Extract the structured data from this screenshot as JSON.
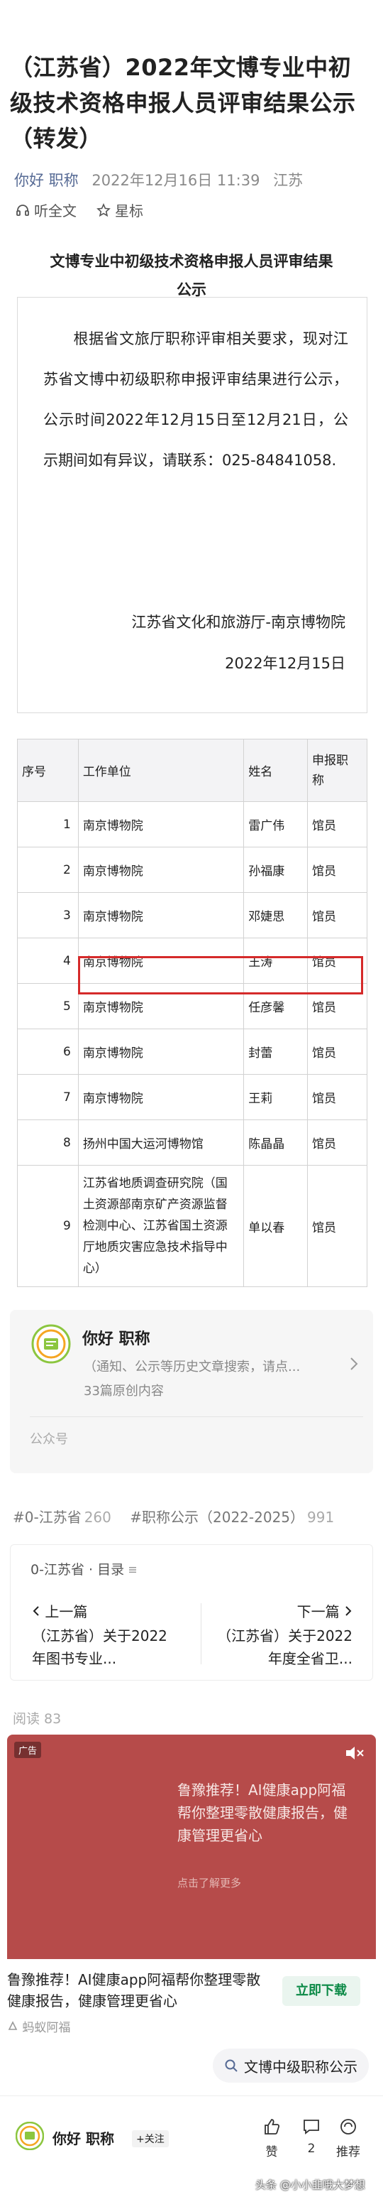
{
  "article": {
    "title": "（江苏省）2022年文博专业中初级技术资格申报人员评审结果公示（转发）",
    "meta": {
      "source": "你好 职称",
      "date": "2022年12月16日 11:39",
      "location": "江苏"
    },
    "actions": {
      "listen_label": "听全文",
      "star_label": "星标"
    }
  },
  "document": {
    "heading_line1": "文博专业中初级技术资格申报人员评审结果",
    "heading_line2": "公示",
    "notice_text": "根据省文旅厅职称评审相关要求，现对江苏省文博中初级职称申报评审结果进行公示，公示时间2022年12月15日至12月21日，公示期间如有异议，请联系：025-84841058.",
    "org": "江苏省文化和旅游厅-南京博物院",
    "date": "2022年12月15日"
  },
  "table": {
    "headers": [
      "序号",
      "工作单位",
      "姓名",
      "申报职称"
    ],
    "rows": [
      {
        "no": "1",
        "unit": "南京博物院",
        "name": "雷广伟",
        "title": "馆员"
      },
      {
        "no": "2",
        "unit": "南京博物院",
        "name": "孙福康",
        "title": "馆员"
      },
      {
        "no": "3",
        "unit": "南京博物院",
        "name": "邓婕思",
        "title": "馆员"
      },
      {
        "no": "4",
        "unit": "南京博物院",
        "name": "王涛",
        "title": "馆员"
      },
      {
        "no": "5",
        "unit": "南京博物院",
        "name": "任彦馨",
        "title": "馆员"
      },
      {
        "no": "6",
        "unit": "南京博物院",
        "name": "封蕾",
        "title": "馆员"
      },
      {
        "no": "7",
        "unit": "南京博物院",
        "name": "王莉",
        "title": "馆员"
      },
      {
        "no": "8",
        "unit": "扬州中国大运河博物馆",
        "name": "陈晶晶",
        "title": "馆员"
      },
      {
        "no": "9",
        "unit": "江苏省地质调查研究院（国土资源部南京矿产资源监督检测中心、江苏省国土资源厅地质灾害应急技术指导中心）",
        "name": "单以春",
        "title": "馆员"
      }
    ],
    "highlight_color": "#d52a2a"
  },
  "account": {
    "name": "你好 职称",
    "description": "（通知、公示等历史文章搜索，请点...",
    "count": "33篇原创内容",
    "type": "公众号",
    "logo_icon": "account-logo-icon"
  },
  "tags": [
    {
      "label": "#0-江苏省",
      "count": "260"
    },
    {
      "label": "#职称公示（2022-2025）",
      "count": "991"
    }
  ],
  "collection": {
    "name": "0-江苏省",
    "directory_label": "目录",
    "prev_label": "上一篇",
    "prev_title": "（江苏省）关于2022年图书专业...",
    "next_label": "下一篇",
    "next_title": "（江苏省）关于2022年度全省卫..."
  },
  "reads": {
    "label": "阅读 83"
  },
  "ad": {
    "badge": "广告",
    "image_text": "鲁豫推荐！AI健康app阿福帮你整理零散健康报告，健康管理更省心",
    "more_label": "点击了解更多",
    "headline": "鲁豫推荐！AI健康app阿福帮你整理零散健康报告，健康管理更省心",
    "cta_label": "立即下载",
    "source": "蚂蚁阿福",
    "accent_color": "#b64b4a"
  },
  "search_suggestion": {
    "label": "文博中级职称公示"
  },
  "bottom_bar": {
    "name": "你好 职称",
    "follow_label": "+关注",
    "like_label": "赞",
    "comment_count": "2",
    "recommend_label": "推荐",
    "watermark": "头条 @小小韭哦大梦想"
  }
}
